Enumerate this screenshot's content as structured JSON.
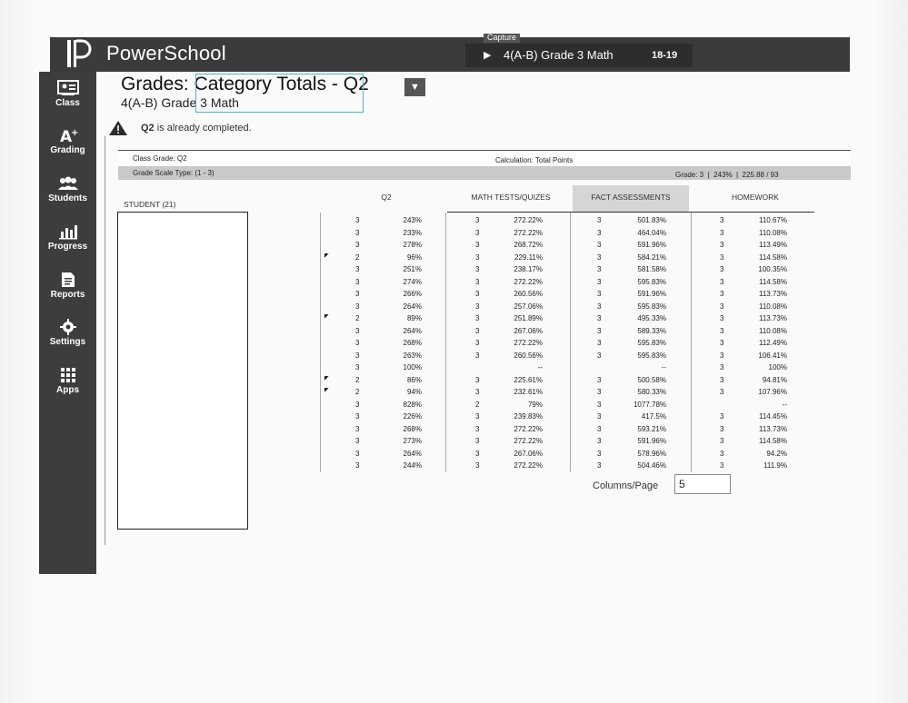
{
  "app": {
    "title": "PowerSchool"
  },
  "capture_tab": "Capture",
  "class_selector": {
    "name": "4(A-B) Grade 3 Math",
    "term": "18-19"
  },
  "nav": [
    {
      "label": "Class",
      "icon": "class-icon"
    },
    {
      "label": "Grading",
      "icon": "grading-icon"
    },
    {
      "label": "Students",
      "icon": "students-icon"
    },
    {
      "label": "Progress",
      "icon": "progress-icon"
    },
    {
      "label": "Reports",
      "icon": "reports-icon"
    },
    {
      "label": "Settings",
      "icon": "gear-icon"
    },
    {
      "label": "Apps",
      "icon": "apps-grid-icon"
    }
  ],
  "page": {
    "title_prefix": "Grades:",
    "title_main": "Category Totals - Q2",
    "subtitle": "4(A-B) Grade 3 Math"
  },
  "warning": {
    "term": "Q2",
    "text": "is already completed."
  },
  "grade_info": {
    "class_grade": "Class Grade: Q2",
    "calculation": "Calculation: Total Points",
    "scale_type": "Grade Scale Type: (1 - 3)",
    "summary": "Grade: 3  |  243%  |  225.88 / 93"
  },
  "table": {
    "student_header": "STUDENT (21)",
    "columns": [
      "Q2",
      "MATH TESTS/QUIZES",
      "FACT ASSESSMENTS",
      "HOMEWORK"
    ],
    "rows": [
      {
        "flag": false,
        "q2": [
          "3",
          "243%"
        ],
        "math": [
          "3",
          "272.22%"
        ],
        "fact": [
          "3",
          "501.83%"
        ],
        "hw": [
          "3",
          "110.67%"
        ]
      },
      {
        "flag": false,
        "q2": [
          "3",
          "233%"
        ],
        "math": [
          "3",
          "272.22%"
        ],
        "fact": [
          "3",
          "464.04%"
        ],
        "hw": [
          "3",
          "110.08%"
        ]
      },
      {
        "flag": false,
        "q2": [
          "3",
          "278%"
        ],
        "math": [
          "3",
          "268.72%"
        ],
        "fact": [
          "3",
          "591.96%"
        ],
        "hw": [
          "3",
          "113.49%"
        ]
      },
      {
        "flag": true,
        "q2": [
          "2",
          "96%"
        ],
        "math": [
          "3",
          "229.11%"
        ],
        "fact": [
          "3",
          "584.21%"
        ],
        "hw": [
          "3",
          "114.58%"
        ]
      },
      {
        "flag": false,
        "q2": [
          "3",
          "251%"
        ],
        "math": [
          "3",
          "238.17%"
        ],
        "fact": [
          "3",
          "581.58%"
        ],
        "hw": [
          "3",
          "100.35%"
        ]
      },
      {
        "flag": false,
        "q2": [
          "3",
          "274%"
        ],
        "math": [
          "3",
          "272.22%"
        ],
        "fact": [
          "3",
          "595.83%"
        ],
        "hw": [
          "3",
          "114.58%"
        ]
      },
      {
        "flag": false,
        "q2": [
          "3",
          "266%"
        ],
        "math": [
          "3",
          "260.56%"
        ],
        "fact": [
          "3",
          "591.96%"
        ],
        "hw": [
          "3",
          "113.73%"
        ]
      },
      {
        "flag": false,
        "q2": [
          "3",
          "264%"
        ],
        "math": [
          "3",
          "257.06%"
        ],
        "fact": [
          "3",
          "595.83%"
        ],
        "hw": [
          "3",
          "110.08%"
        ]
      },
      {
        "flag": true,
        "q2": [
          "2",
          "89%"
        ],
        "math": [
          "3",
          "251.89%"
        ],
        "fact": [
          "3",
          "495.33%"
        ],
        "hw": [
          "3",
          "113.73%"
        ]
      },
      {
        "flag": false,
        "q2": [
          "3",
          "264%"
        ],
        "math": [
          "3",
          "267.06%"
        ],
        "fact": [
          "3",
          "589.33%"
        ],
        "hw": [
          "3",
          "110.08%"
        ]
      },
      {
        "flag": false,
        "q2": [
          "3",
          "268%"
        ],
        "math": [
          "3",
          "272.22%"
        ],
        "fact": [
          "3",
          "595.83%"
        ],
        "hw": [
          "3",
          "112.49%"
        ]
      },
      {
        "flag": false,
        "q2": [
          "3",
          "263%"
        ],
        "math": [
          "3",
          "260.56%"
        ],
        "fact": [
          "3",
          "595.83%"
        ],
        "hw": [
          "3",
          "106.41%"
        ]
      },
      {
        "flag": false,
        "q2": [
          "3",
          "100%"
        ],
        "math": [
          "",
          "--"
        ],
        "fact": [
          "",
          "--"
        ],
        "hw": [
          "3",
          "100%"
        ]
      },
      {
        "flag": true,
        "q2": [
          "2",
          "86%"
        ],
        "math": [
          "3",
          "225.61%"
        ],
        "fact": [
          "3",
          "500.58%"
        ],
        "hw": [
          "3",
          "94.81%"
        ]
      },
      {
        "flag": true,
        "q2": [
          "2",
          "94%"
        ],
        "math": [
          "3",
          "232.61%"
        ],
        "fact": [
          "3",
          "580.33%"
        ],
        "hw": [
          "3",
          "107.96%"
        ]
      },
      {
        "flag": false,
        "q2": [
          "3",
          "828%"
        ],
        "math": [
          "2",
          "79%"
        ],
        "fact": [
          "3",
          "1077.78%"
        ],
        "hw": [
          "",
          "--"
        ]
      },
      {
        "flag": false,
        "q2": [
          "3",
          "226%"
        ],
        "math": [
          "3",
          "239.83%"
        ],
        "fact": [
          "3",
          "417.5%"
        ],
        "hw": [
          "3",
          "114.45%"
        ]
      },
      {
        "flag": false,
        "q2": [
          "3",
          "268%"
        ],
        "math": [
          "3",
          "272.22%"
        ],
        "fact": [
          "3",
          "593.21%"
        ],
        "hw": [
          "3",
          "113.73%"
        ]
      },
      {
        "flag": false,
        "q2": [
          "3",
          "273%"
        ],
        "math": [
          "3",
          "272.22%"
        ],
        "fact": [
          "3",
          "591.96%"
        ],
        "hw": [
          "3",
          "114.58%"
        ]
      },
      {
        "flag": false,
        "q2": [
          "3",
          "264%"
        ],
        "math": [
          "3",
          "267.06%"
        ],
        "fact": [
          "3",
          "578.96%"
        ],
        "hw": [
          "3",
          "94.2%"
        ]
      },
      {
        "flag": false,
        "q2": [
          "3",
          "244%"
        ],
        "math": [
          "3",
          "272.22%"
        ],
        "fact": [
          "3",
          "504.46%"
        ],
        "hw": [
          "3",
          "111.9%"
        ]
      }
    ]
  },
  "pager": {
    "label": "Columns/Page",
    "value": "5"
  },
  "colors": {
    "topbar": "#3b3b3b",
    "nav": "#3d3d3d",
    "highlight": "#4fb6c8"
  }
}
